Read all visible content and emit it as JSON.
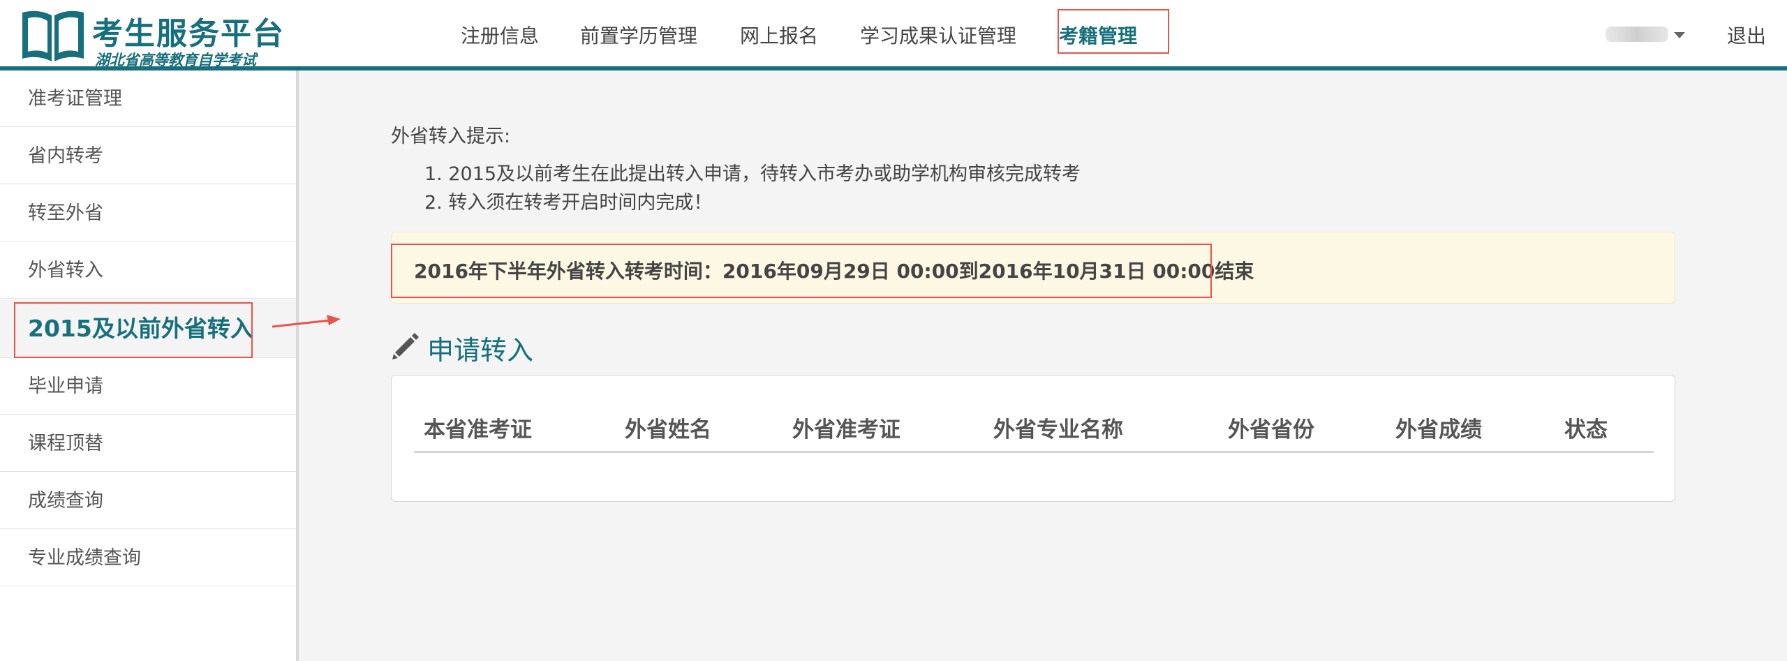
{
  "logo": {
    "title": "考生服务平台",
    "subtitle": "湖北省高等教育自学考试",
    "icon": "open-book-icon"
  },
  "nav": {
    "items": [
      {
        "label": "注册信息"
      },
      {
        "label": "前置学历管理"
      },
      {
        "label": "网上报名"
      },
      {
        "label": "学习成果认证管理"
      },
      {
        "label": "考籍管理",
        "active": true
      }
    ],
    "logout": "退出"
  },
  "sidebar": {
    "items": [
      {
        "label": "准考证管理"
      },
      {
        "label": "省内转考"
      },
      {
        "label": "转至外省"
      },
      {
        "label": "外省转入"
      },
      {
        "label": "2015及以前外省转入",
        "active": true
      },
      {
        "label": "毕业申请"
      },
      {
        "label": "课程顶替"
      },
      {
        "label": "成绩查询"
      },
      {
        "label": "专业成绩查询"
      }
    ]
  },
  "main": {
    "tip_title": "外省转入提示:",
    "tips": [
      "1. 2015及以前考生在此提出转入申请，待转入市考办或助学机构审核完成转考",
      "2. 转入须在转考开启时间内完成！"
    ],
    "notice": "2016年下半年外省转入转考时间：2016年09月29日 00:00到2016年10月31日 00:00结束",
    "section_title": "申请转入",
    "section_icon": "pencil-icon",
    "table_headers": [
      "本省准考证",
      "外省姓名",
      "外省准考证",
      "外省专业名称",
      "外省省份",
      "外省成绩",
      "状态"
    ]
  },
  "colors": {
    "brand": "#166f7d",
    "highlight": "#e8534b",
    "notice_bg": "#fcf8e3"
  }
}
